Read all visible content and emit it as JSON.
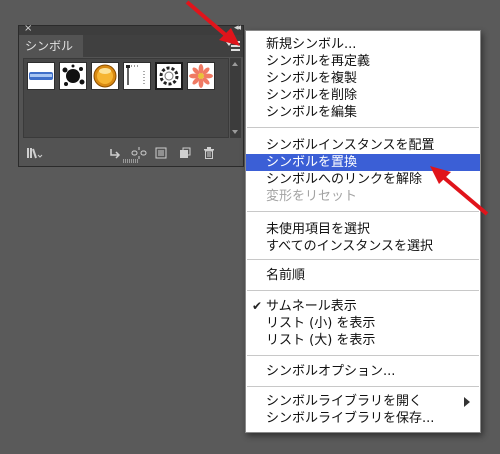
{
  "panel": {
    "close_glyph": "×",
    "collapse_glyph": "◂◂",
    "tab_label": "シンボル",
    "swatches": [
      "brush-stroke-swatch",
      "splat-swatch",
      "orange-ball-swatch",
      "dotted-frame-swatch",
      "ring-swatch",
      "flower-swatch"
    ],
    "footer_icons": [
      "symbol-library-icon",
      "place-symbol-icon",
      "break-link-icon",
      "symbol-options-icon",
      "new-symbol-icon",
      "delete-icon"
    ]
  },
  "menu": {
    "items": [
      {
        "label": "新規シンボル..."
      },
      {
        "label": "シンボルを再定義"
      },
      {
        "label": "シンボルを複製"
      },
      {
        "label": "シンボルを削除"
      },
      {
        "label": "シンボルを編集"
      },
      {
        "label": "シンボルインスタンスを配置"
      },
      {
        "label": "シンボルを置換",
        "highlighted": true
      },
      {
        "label": "シンボルへのリンクを解除"
      },
      {
        "label": "変形をリセット",
        "disabled": true
      },
      {
        "label": "未使用項目を選択"
      },
      {
        "label": "すべてのインスタンスを選択"
      },
      {
        "label": "名前順"
      },
      {
        "label": "サムネール表示",
        "checked": true
      },
      {
        "label": "リスト (小) を表示"
      },
      {
        "label": "リスト (大) を表示"
      },
      {
        "label": "シンボルオプション..."
      },
      {
        "label": "シンボルライブラリを開く",
        "submenu": true
      },
      {
        "label": "シンボルライブラリを保存..."
      }
    ],
    "check_glyph": "✔"
  },
  "colors": {
    "highlight": "#3b5fd6",
    "annotation_arrow": "#e0141b",
    "background": "#5a5a5a"
  }
}
